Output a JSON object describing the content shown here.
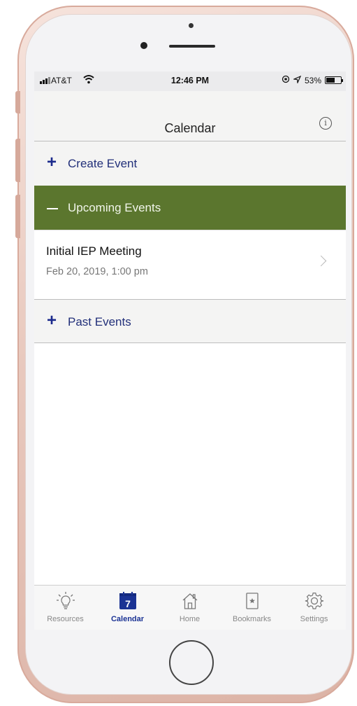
{
  "status_bar": {
    "carrier": "AT&T",
    "time": "12:46 PM",
    "battery": "53%",
    "battery_level": 0.53
  },
  "nav": {
    "title": "Calendar",
    "info_icon": "info-icon"
  },
  "sections": {
    "create_event": {
      "icon": "plus-icon",
      "label": "Create Event"
    },
    "upcoming_events": {
      "icon": "minus-icon",
      "label": "Upcoming Events",
      "color": "#5b762e"
    },
    "past_events": {
      "icon": "plus-icon",
      "label": "Past Events"
    }
  },
  "events": [
    {
      "title": "Initial IEP Meeting",
      "datetime": "Feb 20, 2019, 1:00 pm"
    }
  ],
  "tabs": [
    {
      "label": "Resources",
      "icon": "lightbulb-icon",
      "active": false
    },
    {
      "label": "Calendar",
      "icon": "calendar-icon",
      "badge": "7",
      "active": true
    },
    {
      "label": "Home",
      "icon": "home-icon",
      "active": false
    },
    {
      "label": "Bookmarks",
      "icon": "bookmark-icon",
      "active": false
    },
    {
      "label": "Settings",
      "icon": "gear-icon",
      "active": false
    }
  ],
  "colors": {
    "accent": "#1b3394",
    "section_header": "#5b762e"
  }
}
